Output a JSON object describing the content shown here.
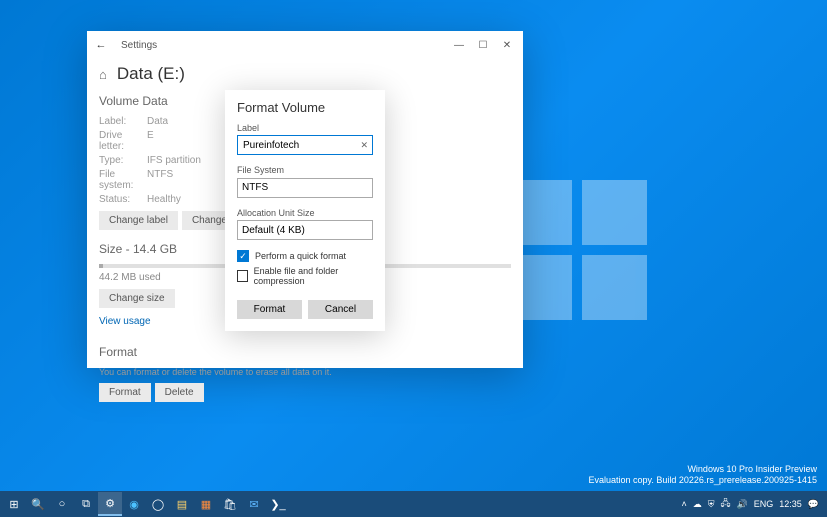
{
  "window": {
    "appName": "Settings",
    "pageTitle": "Data (E:)"
  },
  "volumeData": {
    "heading": "Volume Data",
    "rows": {
      "labelKey": "Label:",
      "labelVal": "Data",
      "driveKey": "Drive letter:",
      "driveVal": "E",
      "typeKey": "Type:",
      "typeVal": "IFS partition",
      "fsKey": "File system:",
      "fsVal": "NTFS",
      "statusKey": "Status:",
      "statusVal": "Healthy"
    },
    "buttons": {
      "changeLabel": "Change label",
      "changeDrive": "Change drive letter"
    }
  },
  "size": {
    "heading": "Size - 14.4 GB",
    "used": "44.2 MB used",
    "changeSize": "Change size",
    "viewUsage": "View usage"
  },
  "formatSection": {
    "heading": "Format",
    "desc": "You can format or delete the volume to erase all data on it.",
    "formatBtn": "Format",
    "deleteBtn": "Delete"
  },
  "dialog": {
    "title": "Format Volume",
    "labelLabel": "Label",
    "labelValue": "Pureinfotech",
    "fsLabel": "File System",
    "fsValue": "NTFS",
    "allocLabel": "Allocation Unit Size",
    "allocValue": "Default (4 KB)",
    "quickFormat": "Perform a quick format",
    "compression": "Enable file and folder compression",
    "formatBtn": "Format",
    "cancelBtn": "Cancel"
  },
  "watermark": {
    "line1": "Windows 10 Pro Insider Preview",
    "line2": "Evaluation copy. Build 20226.rs_prerelease.200925-1415"
  },
  "tray": {
    "lang": "ENG",
    "time": "12:35"
  }
}
